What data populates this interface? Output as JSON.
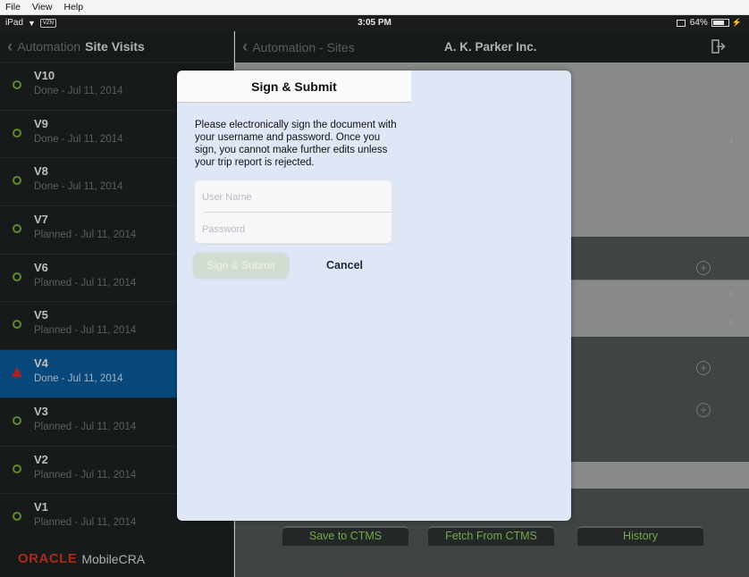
{
  "menubar": {
    "items": [
      "File",
      "View",
      "Help"
    ]
  },
  "statusbar": {
    "device": "iPad",
    "carrier": "VZN",
    "time": "3:05 PM",
    "battery": "64%"
  },
  "sidebar": {
    "back_label": "Automation",
    "title": "Site Visits",
    "visits": [
      {
        "name": "V10",
        "status": "Done - Jul 11, 2014"
      },
      {
        "name": "V9",
        "status": "Done - Jul 11, 2014"
      },
      {
        "name": "V8",
        "status": "Done - Jul 11, 2014"
      },
      {
        "name": "V7",
        "status": "Planned - Jul 11, 2014"
      },
      {
        "name": "V6",
        "status": "Planned - Jul 11, 2014"
      },
      {
        "name": "V5",
        "status": "Planned - Jul 11, 2014"
      },
      {
        "name": "V4",
        "status": "Done - Jul 11, 2014"
      },
      {
        "name": "V3",
        "status": "Planned - Jul 11, 2014"
      },
      {
        "name": "V2",
        "status": "Planned - Jul 11, 2014"
      },
      {
        "name": "V1",
        "status": "Planned - Jul 11, 2014"
      }
    ],
    "brand_oracle": "ORACLE",
    "brand_product": "MobileCRA"
  },
  "main": {
    "back_label": "Automation - Sites",
    "title": "A. K. Parker Inc.",
    "buttons": {
      "save": "Save to CTMS",
      "fetch": "Fetch From CTMS",
      "history": "History"
    }
  },
  "dialog": {
    "title": "Sign & Submit",
    "message": "Please electronically sign the document with your username and password. Once you sign, you cannot make further edits unless your trip report is rejected.",
    "username_placeholder": "User Name",
    "password_placeholder": "Password",
    "submit_label": "Sign & Submit",
    "cancel_label": "Cancel"
  },
  "colors": {
    "accent_selected": "#0b5896",
    "status_done": "#76a837",
    "warning": "#d02a2a",
    "button_text": "#8fcb5a"
  }
}
